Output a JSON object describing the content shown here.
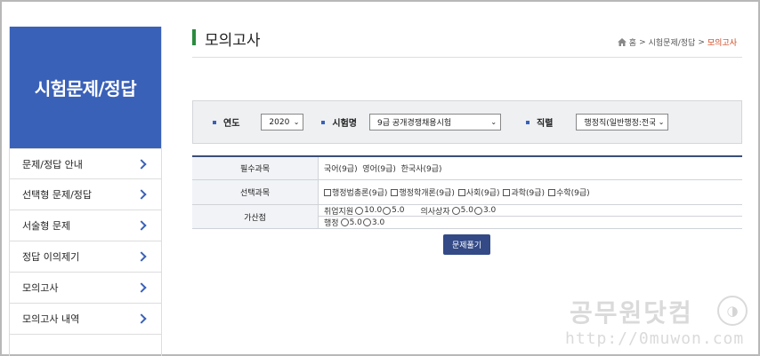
{
  "sidebar": {
    "title": "시험문제/정답",
    "items": [
      {
        "label": "문제/정답 안내"
      },
      {
        "label": "선택형 문제/정답"
      },
      {
        "label": "서술형 문제"
      },
      {
        "label": "정답 이의제기"
      },
      {
        "label": "모의고사"
      },
      {
        "label": "모의고사 내역"
      }
    ]
  },
  "header": {
    "title": "모의고사",
    "breadcrumb": {
      "home": "홈",
      "sep": ">",
      "level1": "시험문제/정답",
      "current": "모의고사"
    }
  },
  "filter": {
    "year_label": "연도",
    "year_value": "2020",
    "exam_label": "시험명",
    "exam_value": "9급 공개경쟁채용시험",
    "job_label": "직렬",
    "job_value": "행정직(일반행정:전국"
  },
  "table": {
    "required_label": "필수과목",
    "required_value": "국어(9급)  영어(9급)  한국사(9급)",
    "elective_label": "선택과목",
    "electives": [
      "행정법총론(9급)",
      "행정학개론(9급)",
      "사회(9급)",
      "과학(9급)",
      "수학(9급)"
    ],
    "bonus_label": "가산점",
    "bonus_line1_a": "취업지원",
    "bonus_line1_a_opts": [
      "10.0",
      "5.0"
    ],
    "bonus_line1_b": "의사상자",
    "bonus_line1_b_opts": [
      "5.0",
      "3.0"
    ],
    "bonus_line2_a": "행정",
    "bonus_line2_a_opts": [
      "5.0",
      "3.0"
    ]
  },
  "solve_button": "문제풀기",
  "watermark": {
    "text": "공무원닷컴",
    "url": "http://0muwon.com"
  },
  "colors": {
    "primary": "#3a61b8",
    "button": "#334a87",
    "accent_title": "#2b8b3f",
    "crumb_active": "#d0451b"
  }
}
